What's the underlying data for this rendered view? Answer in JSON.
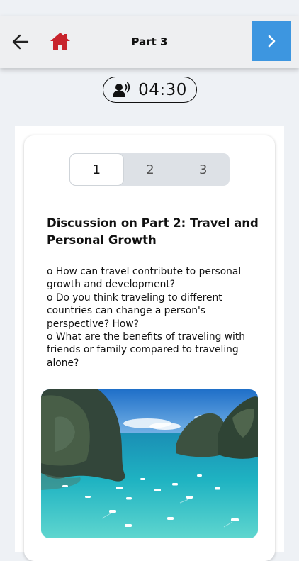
{
  "header": {
    "title": "Part 3",
    "back_icon": "arrow-left-icon",
    "home_icon": "home-icon",
    "home_color": "#c8232c",
    "next_icon": "chevron-right-icon",
    "next_color": "#3d96e0"
  },
  "timer": {
    "icon": "speaker-person-icon",
    "time": "04:30"
  },
  "tabs": [
    {
      "label": "1",
      "active": true
    },
    {
      "label": "2",
      "active": false
    },
    {
      "label": "3",
      "active": false
    }
  ],
  "content": {
    "heading": "Discussion on Part 2: Travel and Personal Growth",
    "questions": [
      "o How can travel contribute to personal growth and development?",
      "o Do you think traveling to different countries can change a person's perspective? How?",
      "o What are the benefits of traveling with friends or family compared to traveling alone?"
    ],
    "image": "tropical-bay-photo"
  }
}
